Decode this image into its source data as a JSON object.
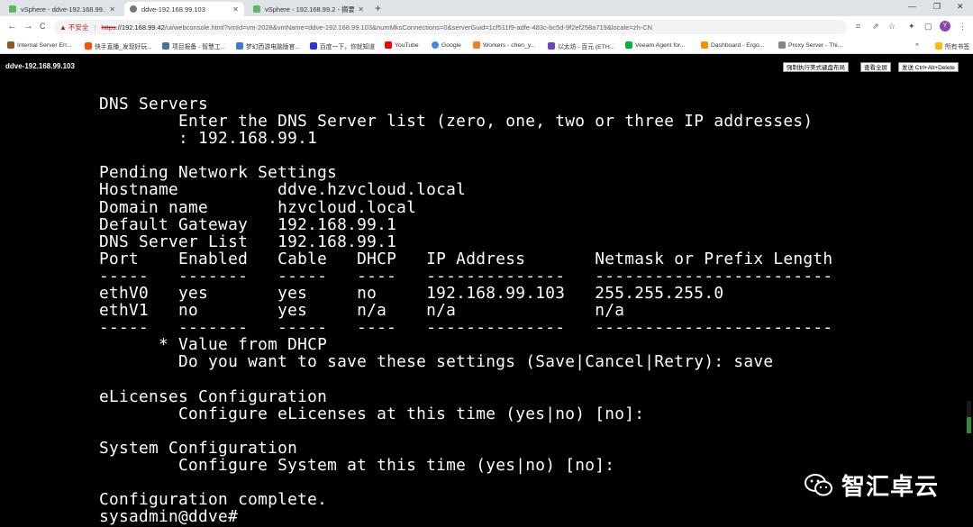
{
  "browser": {
    "tabs": [
      {
        "title": "vSphere - ddve-192.168.99.10",
        "active": false,
        "icon_color": "#5cb85c"
      },
      {
        "title": "ddve-192.168.99.103",
        "active": true,
        "icon_color": "#777777"
      },
      {
        "title": "vSphere - 192.168.99.2 - 摘要",
        "active": false,
        "icon_color": "#5cb85c"
      }
    ],
    "new_tab_label": "+",
    "window_controls": [
      "—",
      "❐",
      "✕"
    ],
    "nav": {
      "back": "←",
      "forward": "→",
      "reload": "C"
    },
    "address": {
      "warning_icon": "▲",
      "insecure_label": "不安全",
      "separator": "|",
      "scheme": "https",
      "host": "://192.168.99.42",
      "path": "/ui/webconsole.html?vmId=vm-2028&vmName=ddve-192.168.99.103&numMksConnections=0&serverGuid=1cf511f9-adfe-483c-bc5d-9f2ef258a719&locale=zh-CN"
    },
    "right_icons": [
      "⌗",
      "⇗",
      "☆",
      "✦",
      "▢"
    ],
    "avatar_label": "Y",
    "menu_icon": "⋮",
    "bookmarks": [
      {
        "label": "Internal Server Err...",
        "color": "#8b5a2b"
      },
      {
        "label": "快手直播_发现好玩...",
        "color": "#ff5000"
      },
      {
        "label": "项目报备 - 智慧工...",
        "color": "#4a6fa5"
      },
      {
        "label": "梦幻西游电脑版官...",
        "color": "#3c78d8"
      },
      {
        "label": "百度一下，你就知道",
        "color": "#2932e1"
      },
      {
        "label": "YouTube",
        "color": "#ff0000"
      },
      {
        "label": "Google",
        "color": "#4285f4"
      },
      {
        "label": "Workers - chen_y...",
        "color": "#f38020"
      },
      {
        "label": "以太坊 - 百元 (ETH...",
        "color": "#6f42c1"
      },
      {
        "label": "Veeam Agent for...",
        "color": "#00b336"
      },
      {
        "label": "Dashboard - Ergo...",
        "color": "#ff8c00"
      },
      {
        "label": "Proxy Server - Thi...",
        "color": "#888888"
      }
    ],
    "bookmarks_more": "»",
    "all_bookmarks": "所有书签"
  },
  "console": {
    "vm_name": "ddve-192.168.99.103",
    "buttons": [
      "强制执行美式键盘布局",
      "查看全屏",
      "发送 Ctrl+Alt+Delete"
    ]
  },
  "terminal": {
    "lines": [
      "DNS Servers",
      "        Enter the DNS Server list (zero, one, two or three IP addresses)",
      "        : 192.168.99.1",
      "",
      "Pending Network Settings",
      "Hostname          ddve.hzvcloud.local",
      "Domain name       hzvcloud.local",
      "Default Gateway   192.168.99.1",
      "DNS Server List   192.168.99.1",
      "Port    Enabled   Cable   DHCP   IP Address       Netmask or Prefix Length",
      "-----   -------   -----   ----   --------------   ------------------------",
      "ethV0   yes       yes     no     192.168.99.103   255.255.255.0",
      "ethV1   no        yes     n/a    n/a              n/a",
      "-----   -------   -----   ----   --------------   ------------------------",
      "      * Value from DHCP",
      "        Do you want to save these settings (Save|Cancel|Retry): save",
      "",
      "eLicenses Configuration",
      "        Configure eLicenses at this time (yes|no) [no]:",
      "",
      "System Configuration",
      "        Configure System at this time (yes|no) [no]:",
      "",
      "Configuration complete.",
      "sysadmin@ddve#"
    ]
  },
  "watermark": {
    "text": "智汇卓云",
    "icon": "wechat-logo"
  }
}
